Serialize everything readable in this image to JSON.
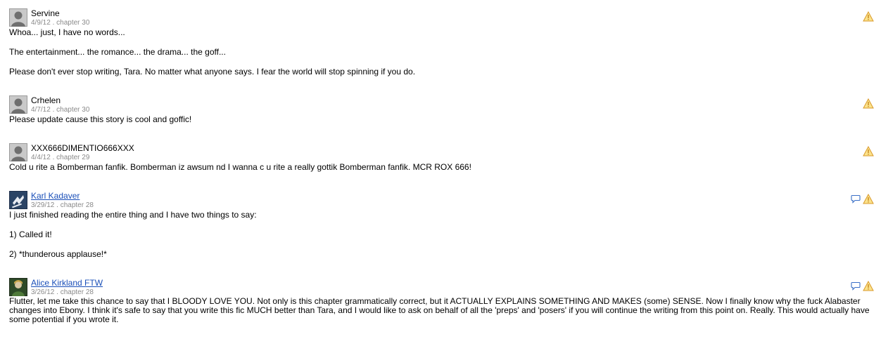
{
  "reviews": [
    {
      "name": "Servine",
      "meta": "4/9/12 . chapter 30",
      "is_link": false,
      "avatar": "default-silhouette",
      "has_reply": false,
      "paragraphs": [
        "Whoa... just, I have no words...",
        "The entertainment... the romance... the drama... the goff...",
        "Please don't ever stop writing, Tara. No matter what anyone says. I fear the world will stop spinning if you do."
      ]
    },
    {
      "name": "Crhelen",
      "meta": "4/7/12 . chapter 30",
      "is_link": false,
      "avatar": "default-silhouette",
      "has_reply": false,
      "paragraphs": [
        "Please update cause this story is cool and goffic!"
      ]
    },
    {
      "name": "XXX666DIMENTIO666XXX",
      "meta": "4/4/12 . chapter 29",
      "is_link": false,
      "avatar": "default-silhouette",
      "has_reply": false,
      "paragraphs": [
        "Cold u rite a Bomberman fanfik. Bomberman iz awsum nd I wanna c u rite a really gottik Bomberman fanfik. MCR ROX 666!"
      ]
    },
    {
      "name": "Karl Kadaver",
      "meta": "3/29/12 . chapter 28",
      "is_link": true,
      "avatar": "custom-dark-blue",
      "has_reply": true,
      "paragraphs": [
        "I just finished reading the entire thing and I have two things to say:",
        "1) Called it!",
        "2) *thunderous applause!*"
      ]
    },
    {
      "name": "Alice Kirkland FTW",
      "meta": "3/26/12 . chapter 28",
      "is_link": true,
      "avatar": "custom-dark-green",
      "has_reply": true,
      "paragraphs": [
        "Flutter, let me take this chance to say that I BLOODY LOVE YOU. Not only is this chapter grammatically correct, but it ACTUALLY EXPLAINS SOMETHING AND MAKES (some) SENSE. Now I finally know why the fuck Alabaster changes into Ebony. I think it's safe to say that you write this fic MUCH better than Tara, and I would like to ask on behalf of all the 'preps' and 'posers' if you will continue the writing from this point on. Really. This would actually have some potential if you wrote it."
      ]
    }
  ],
  "icons": {
    "report": "warning-triangle-icon",
    "reply": "speech-bubble-icon"
  },
  "colors": {
    "link": "#1a4fb8",
    "meta": "#8a8a8a",
    "report_fill": "#fbe28a",
    "report_stroke": "#d99a2b",
    "reply_stroke": "#3a6fc7"
  }
}
